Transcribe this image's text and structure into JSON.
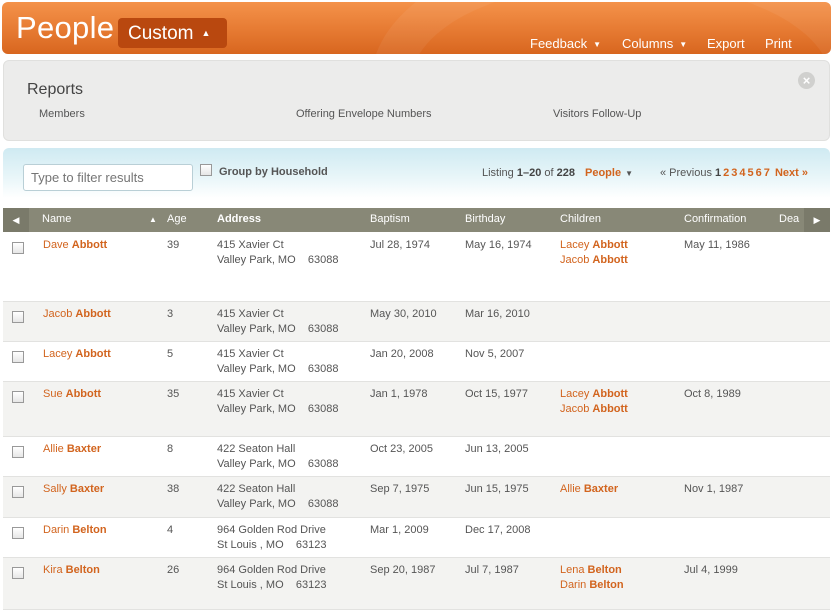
{
  "header": {
    "title": "People",
    "view": "Custom",
    "nav": [
      "Feedback",
      "Columns",
      "Export",
      "Print"
    ]
  },
  "reports": {
    "title": "Reports",
    "links": [
      "Members",
      "Offering Envelope Numbers",
      "Visitors Follow-Up"
    ]
  },
  "filter": {
    "placeholder": "Type to filter results",
    "group_label": "Group by Household",
    "listing_prefix": "Listing ",
    "listing_range": "1–20",
    "listing_of": " of ",
    "listing_total": "228",
    "people_dropdown": "People",
    "prev_label": "« Previous",
    "current_page": "1",
    "pages": [
      "2",
      "3",
      "4",
      "5",
      "6",
      "7"
    ],
    "next_label": "Next »"
  },
  "columns": [
    "Name",
    "Age",
    "Address",
    "Baptism",
    "Birthday",
    "Children",
    "Confirmation",
    "Dea"
  ],
  "rows": [
    {
      "first": "Dave",
      "last": "Abbott",
      "age": "39",
      "addr1": "415 Xavier Ct",
      "addr2": "Valley Park, MO    63088",
      "baptism": "Jul 28, 1974",
      "birthday": "May 16, 1974",
      "children": [
        {
          "first": "Lacey",
          "last": "Abbott"
        },
        {
          "first": "Jacob",
          "last": "Abbott"
        }
      ],
      "confirmation": "May 11, 1986"
    },
    {
      "first": "Jacob",
      "last": "Abbott",
      "age": "3",
      "addr1": "415 Xavier Ct",
      "addr2": "Valley Park, MO    63088",
      "baptism": "May 30, 2010",
      "birthday": "Mar 16, 2010",
      "children": [],
      "confirmation": ""
    },
    {
      "first": "Lacey",
      "last": "Abbott",
      "age": "5",
      "addr1": "415 Xavier Ct",
      "addr2": "Valley Park, MO    63088",
      "baptism": "Jan 20, 2008",
      "birthday": "Nov 5, 2007",
      "children": [],
      "confirmation": ""
    },
    {
      "first": "Sue",
      "last": "Abbott",
      "age": "35",
      "addr1": "415 Xavier Ct",
      "addr2": "Valley Park, MO    63088",
      "baptism": "Jan 1, 1978",
      "birthday": "Oct 15, 1977",
      "children": [
        {
          "first": "Lacey",
          "last": "Abbott"
        },
        {
          "first": "Jacob",
          "last": "Abbott"
        }
      ],
      "confirmation": "Oct 8, 1989"
    },
    {
      "first": "Allie",
      "last": "Baxter",
      "age": "8",
      "addr1": "422 Seaton Hall",
      "addr2": "Valley Park, MO    63088",
      "baptism": "Oct 23, 2005",
      "birthday": "Jun 13, 2005",
      "children": [],
      "confirmation": ""
    },
    {
      "first": "Sally",
      "last": "Baxter",
      "age": "38",
      "addr1": "422 Seaton Hall",
      "addr2": "Valley Park, MO    63088",
      "baptism": "Sep 7, 1975",
      "birthday": "Jun 15, 1975",
      "children": [
        {
          "first": "Allie",
          "last": "Baxter"
        }
      ],
      "confirmation": "Nov 1, 1987"
    },
    {
      "first": "Darin",
      "last": "Belton",
      "age": "4",
      "addr1": "964 Golden Rod Drive",
      "addr2": "St Louis , MO    63123",
      "baptism": "Mar 1, 2009",
      "birthday": "Dec 17, 2008",
      "children": [],
      "confirmation": ""
    },
    {
      "first": "Kira",
      "last": "Belton",
      "age": "26",
      "addr1": "964 Golden Rod Drive",
      "addr2": "St Louis , MO    63123",
      "baptism": "Sep 20, 1987",
      "birthday": "Jul 7, 1987",
      "children": [
        {
          "first": "Lena",
          "last": "Belton"
        },
        {
          "first": "Darin",
          "last": "Belton"
        }
      ],
      "confirmation": "Jul 4, 1999"
    }
  ]
}
